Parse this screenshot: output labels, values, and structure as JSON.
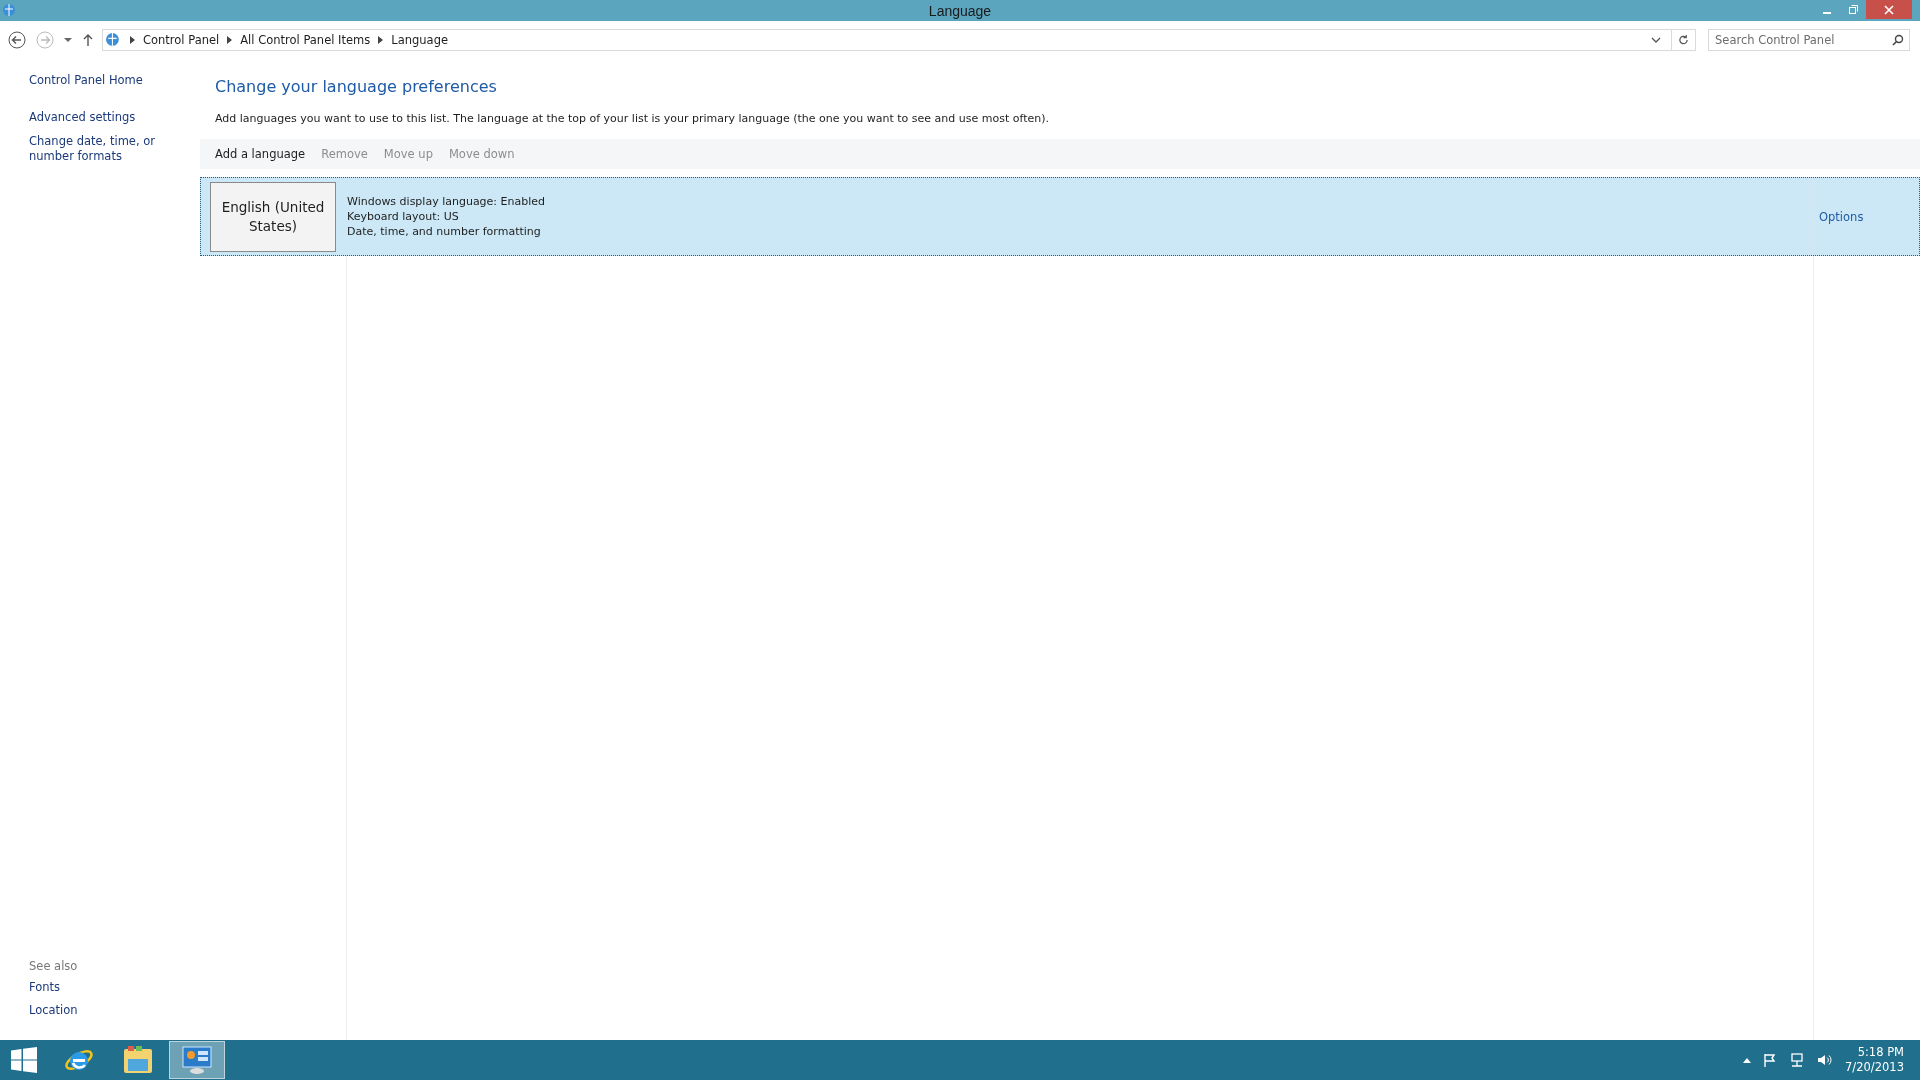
{
  "window": {
    "title": "Language"
  },
  "address_bar": {
    "crumbs": [
      "Control Panel",
      "All Control Panel Items",
      "Language"
    ]
  },
  "search": {
    "placeholder": "Search Control Panel"
  },
  "sidebar": {
    "links": [
      "Control Panel Home",
      "Advanced settings",
      "Change date, time, or number formats"
    ],
    "see_also": {
      "heading": "See also",
      "links": [
        "Fonts",
        "Location"
      ]
    }
  },
  "heading": "Change your language preferences",
  "description": "Add languages you want to use to this list. The language at the top of your list is your primary language (the one you want to see and use most often).",
  "toolbar": [
    {
      "label": "Add a language",
      "disabled": false
    },
    {
      "label": "Remove",
      "disabled": true
    },
    {
      "label": "Move up",
      "disabled": true
    },
    {
      "label": "Move down",
      "disabled": true
    }
  ],
  "languages": [
    {
      "name": "English (United States)",
      "details": [
        "Windows display language: Enabled",
        "Keyboard layout: US",
        "Date, time, and number formatting"
      ],
      "options": "Options",
      "selected": true
    }
  ],
  "taskbar": {
    "apps": [
      {
        "kind": "browser",
        "selected": false
      },
      {
        "kind": "folder",
        "selected": false
      },
      {
        "kind": "control-panel",
        "selected": true
      }
    ],
    "time": "5:18 PM",
    "date": "7/20/2013"
  }
}
